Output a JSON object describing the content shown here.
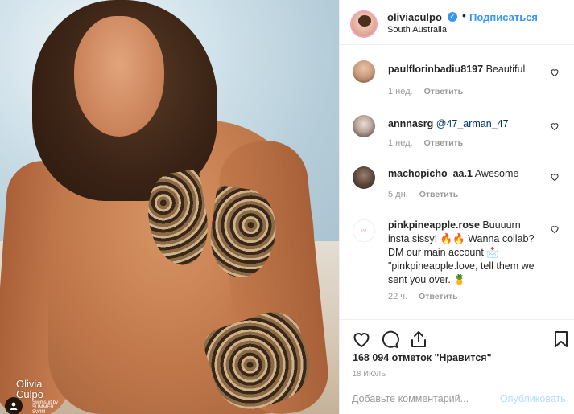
{
  "photo": {
    "overlay_name": "Olivia Culpo",
    "overlay_credit": "Swimsuit by SUMMER SWIM"
  },
  "post": {
    "username": "oliviaculpo",
    "verified": true,
    "separator": "•",
    "follow_label": "Подписаться",
    "location": "South Australia"
  },
  "comments": [
    {
      "username": "paulflorinbadiu8197",
      "text": "Beautiful",
      "mention": "",
      "time": "1 нед.",
      "reply": "Ответить"
    },
    {
      "username": "annnasrg",
      "text": "",
      "mention": "@47_arman_47",
      "time": "1 нед.",
      "reply": "Ответить"
    },
    {
      "username": "machopicho_aa.1",
      "text": "Awesome",
      "mention": "",
      "time": "5 дн.",
      "reply": "Ответить"
    },
    {
      "username": "pinkpineapple.rose",
      "text": "Buuuurn insta sissy! 🔥🔥 Wanna collab? DM our main account 📩 \"pinkpineapple.love, tell them we sent you over. 🍍",
      "mention": "",
      "time": "22 ч.",
      "reply": "Ответить"
    }
  ],
  "stats": {
    "likes": "168 094 отметок \"Нравится\"",
    "date": "18 ИЮЛЬ"
  },
  "add_comment": {
    "placeholder": "Добавьте комментарий...",
    "post_label": "Опубликовать"
  },
  "colors": {
    "accent": "#3897f0",
    "muted": "#999999",
    "text": "#262626",
    "border": "#efefef",
    "post_disabled": "#b2dffc"
  },
  "icons": [
    "heart-icon",
    "comment-icon",
    "share-icon",
    "bookmark-icon",
    "verified-icon",
    "user-tag-icon"
  ]
}
